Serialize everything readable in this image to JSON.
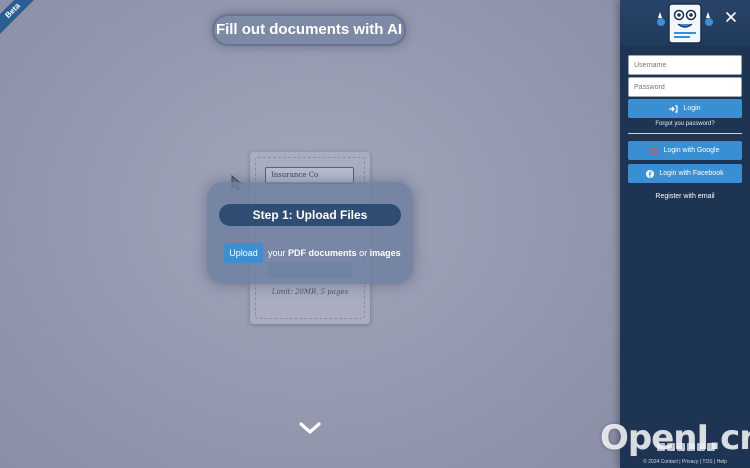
{
  "beta_label": "Beta",
  "hero": {
    "title": "Fill out documents with AI"
  },
  "preview": {
    "field_value": "Insurance Co",
    "limit_text": "Limit: 20MB, 5 pages"
  },
  "step": {
    "title": "Step 1: Upload Files",
    "upload_label": "Upload",
    "text_your": "your",
    "text_pdf": "PDF documents",
    "text_or": "or",
    "text_images": "images"
  },
  "sidebar": {
    "username_placeholder": "Username",
    "password_placeholder": "Password",
    "login_label": "Login",
    "forgot_label": "Forgot you password?",
    "google_label": "Login with Google",
    "facebook_label": "Login with Facebook",
    "register_label": "Register with email",
    "footer": "© 2024 Contact | Privacy | TOS | Help"
  },
  "watermark": "OpenI.cn",
  "colors": {
    "primary_button": "#3a8fd3",
    "sidebar_bg": "#1d3452",
    "step_title_bg": "#2f4d72"
  },
  "icons": {
    "login": "sign-in-icon",
    "google": "google-icon",
    "facebook": "facebook-icon",
    "close": "close-icon",
    "scroll": "chevron-down-icon"
  }
}
